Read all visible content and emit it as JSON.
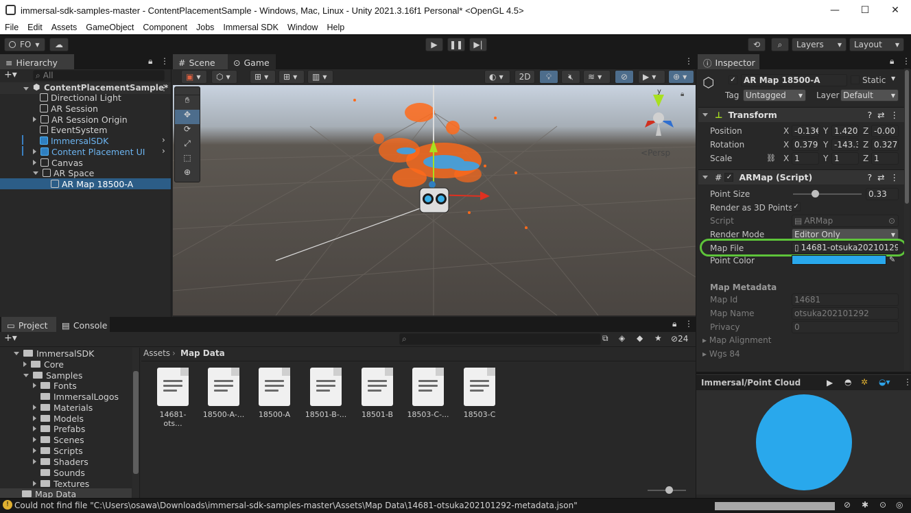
{
  "window": {
    "title": "immersal-sdk-samples-master - ContentPlacementSample - Windows, Mac, Linux - Unity 2021.3.16f1 Personal* <OpenGL 4.5>",
    "controls": [
      "—",
      "☐",
      "✕"
    ]
  },
  "menu": [
    "File",
    "Edit",
    "Assets",
    "GameObject",
    "Component",
    "Jobs",
    "Immersal SDK",
    "Window",
    "Help"
  ],
  "toolbar": {
    "account": "FO",
    "layers": "Layers",
    "layout": "Layout"
  },
  "hierarchy": {
    "tab": "Hierarchy",
    "search_placeholder": "All",
    "scene": "ContentPlacementSample*",
    "items": [
      {
        "label": "Directional Light"
      },
      {
        "label": "AR Session"
      },
      {
        "label": "AR Session Origin"
      },
      {
        "label": "EventSystem"
      },
      {
        "label": "ImmersalSDK"
      },
      {
        "label": "Content Placement UI"
      },
      {
        "label": "Canvas"
      },
      {
        "label": "AR Space"
      },
      {
        "label": "AR Map 18500-A"
      }
    ]
  },
  "scene_view": {
    "tabs": [
      "Scene",
      "Game"
    ],
    "mode_2d": "2D",
    "persp": "Persp",
    "gizmo_y": "y"
  },
  "inspector": {
    "tab": "Inspector",
    "object_name": "AR Map 18500-A",
    "static_label": "Static",
    "tag_label": "Tag",
    "tag_value": "Untagged",
    "layer_label": "Layer",
    "layer_value": "Default",
    "transform": {
      "title": "Transform",
      "position_label": "Position",
      "rotation_label": "Rotation",
      "scale_label": "Scale",
      "position": {
        "x": "-0.13€",
        "y": "1.420",
        "z": "-0.00"
      },
      "rotation": {
        "x": "0.379",
        "y": "-143.3",
        "z": "0.327"
      },
      "scale": {
        "x": "1",
        "y": "1",
        "z": "1"
      },
      "axis_x": "X",
      "axis_y": "Y",
      "axis_z": "Z"
    },
    "armap": {
      "title": "ARMap (Script)",
      "point_size_label": "Point Size",
      "point_size": "0.33",
      "render3d_label": "Render as 3D Points",
      "script_label": "Script",
      "script_value": "ARMap",
      "render_mode_label": "Render Mode",
      "render_mode_value": "Editor Only",
      "map_file_label": "Map File",
      "map_file_value": "14681-otsuka20210129",
      "point_color_label": "Point Color",
      "point_color": "#29a8ec"
    },
    "metadata": {
      "title": "Map Metadata",
      "map_id_label": "Map Id",
      "map_id": "14681",
      "map_name_label": "Map Name",
      "map_name": "otsuka202101292",
      "privacy_label": "Privacy",
      "privacy": "0",
      "alignment_label": "Map Alignment",
      "wgs_label": "Wgs 84"
    },
    "preview": {
      "title": "Immersal/Point Cloud"
    }
  },
  "project": {
    "tabs": [
      "Project",
      "Console"
    ],
    "hidden_count": "24",
    "tree": [
      {
        "label": "ImmersalSDK",
        "indent": 0,
        "open": true
      },
      {
        "label": "Core",
        "indent": 1,
        "open": false
      },
      {
        "label": "Samples",
        "indent": 1,
        "open": true
      },
      {
        "label": "Fonts",
        "indent": 2,
        "open": false
      },
      {
        "label": "ImmersalLogos",
        "indent": 2,
        "open": null
      },
      {
        "label": "Materials",
        "indent": 2,
        "open": false
      },
      {
        "label": "Models",
        "indent": 2,
        "open": false
      },
      {
        "label": "Prefabs",
        "indent": 2,
        "open": false
      },
      {
        "label": "Scenes",
        "indent": 2,
        "open": false
      },
      {
        "label": "Scripts",
        "indent": 2,
        "open": false
      },
      {
        "label": "Shaders",
        "indent": 2,
        "open": false
      },
      {
        "label": "Sounds",
        "indent": 2,
        "open": null
      },
      {
        "label": "Textures",
        "indent": 2,
        "open": false
      },
      {
        "label": "Map Data",
        "indent": 0,
        "open": null
      }
    ],
    "breadcrumb": [
      "Assets",
      "Map Data"
    ],
    "assets": [
      "14681-ots...",
      "18500-A-...",
      "18500-A",
      "18501-B-...",
      "18501-B",
      "18503-C-...",
      "18503-C"
    ]
  },
  "status": {
    "message": "Could not find file \"C:\\Users\\osawa\\Downloads\\immersal-sdk-samples-master\\Assets\\Map Data\\14681-otsuka202101292-metadata.json\""
  },
  "colors": {
    "accent_blue": "#2c5d87",
    "highlight_green": "#5ec43a",
    "point_cloud_orange": "#ff6a1a"
  }
}
